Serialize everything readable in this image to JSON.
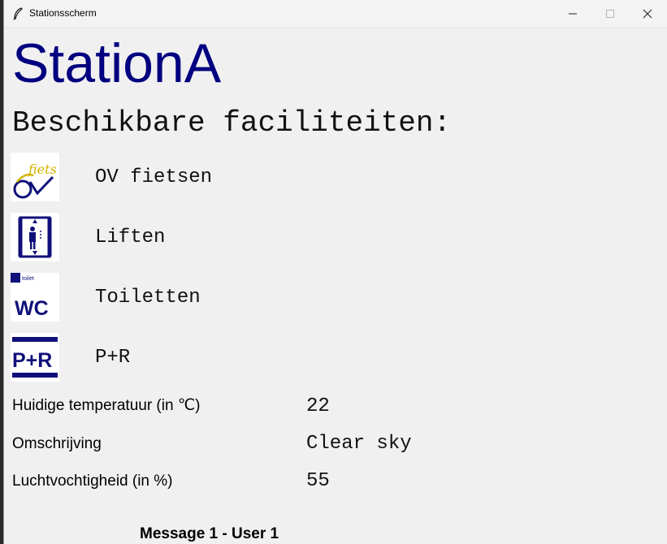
{
  "window": {
    "title": "Stationsscherm",
    "icon": "feather-icon",
    "controls": [
      "minimize-icon",
      "maximize-icon",
      "close-icon"
    ]
  },
  "station": {
    "name": "StationA",
    "color": "#000080"
  },
  "facilities": {
    "heading": "Beschikbare faciliteiten:",
    "items": [
      {
        "label": "OV fietsen",
        "icon": "ov-fiets-icon"
      },
      {
        "label": "Liften",
        "icon": "elevator-icon"
      },
      {
        "label": "Toiletten",
        "icon": "toilet-icon"
      },
      {
        "label": "P+R",
        "icon": "park-and-ride-icon"
      }
    ],
    "icon_texts": {
      "fiets": "fiets",
      "toilet": "toilet",
      "wc": "WC",
      "pr": "P+R"
    }
  },
  "weather": {
    "temperature_label": "Huidige temperatuur (in ℃)",
    "temperature_value": "22",
    "description_label": "Omschrijving",
    "description_value": "Clear sky",
    "humidity_label": "Luchtvochtigheid (in %)",
    "humidity_value": "55"
  },
  "message": "Message 1 - User 1"
}
